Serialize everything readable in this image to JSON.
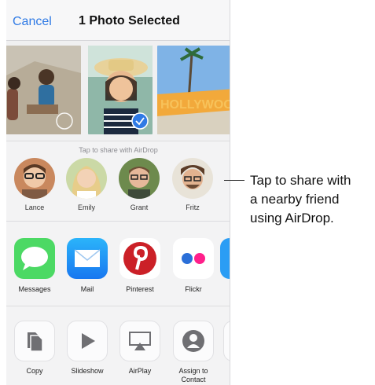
{
  "navbar": {
    "cancel_label": "Cancel",
    "title": "1 Photo Selected"
  },
  "airdrop": {
    "hint": "Tap to share with AirDrop",
    "people": [
      {
        "name": "Lance"
      },
      {
        "name": "Emily"
      },
      {
        "name": "Grant"
      },
      {
        "name": "Fritz"
      }
    ]
  },
  "apps": [
    {
      "label": "Messages",
      "icon": "messages-icon",
      "color": "#4cd964"
    },
    {
      "label": "Mail",
      "icon": "mail-icon",
      "color": "#1d8ef5"
    },
    {
      "label": "Pinterest",
      "icon": "pinterest-icon",
      "color": "#cb2027"
    },
    {
      "label": "Flickr",
      "icon": "flickr-icon",
      "color": "#ffffff"
    }
  ],
  "actions": [
    {
      "label": "Copy",
      "icon": "copy-icon"
    },
    {
      "label": "Slideshow",
      "icon": "play-icon"
    },
    {
      "label": "AirPlay",
      "icon": "airplay-icon"
    },
    {
      "label": "Assign to Contact",
      "icon": "contact-icon"
    }
  ],
  "callout": {
    "lines": [
      "Tap to share with",
      "a nearby friend",
      "using AirDrop."
    ]
  }
}
